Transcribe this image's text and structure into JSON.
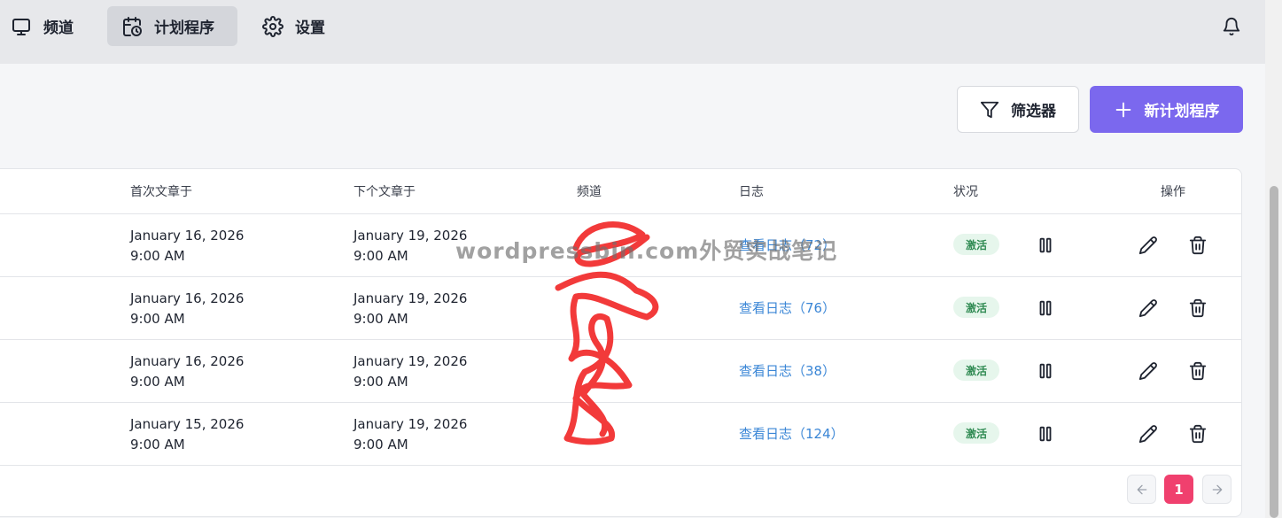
{
  "nav": {
    "channels": "频道",
    "schedules": "计划程序",
    "settings": "设置"
  },
  "actions": {
    "filter": "筛选器",
    "new_schedule": "新计划程序"
  },
  "table": {
    "headers": {
      "first_post": "首次文章于",
      "next_post": "下个文章于",
      "channel": "频道",
      "logs": "日志",
      "status": "状况",
      "actions": "操作"
    },
    "rows": [
      {
        "first_date": "January 16, 2026",
        "first_time": "9:00 AM",
        "next_date": "January 19, 2026",
        "next_time": "9:00 AM",
        "log": "查看日志（72）",
        "status": "激活"
      },
      {
        "first_date": "January 16, 2026",
        "first_time": "9:00 AM",
        "next_date": "January 19, 2026",
        "next_time": "9:00 AM",
        "log": "查看日志（76）",
        "status": "激活"
      },
      {
        "first_date": "January 16, 2026",
        "first_time": "9:00 AM",
        "next_date": "January 19, 2026",
        "next_time": "9:00 AM",
        "log": "查看日志（38）",
        "status": "激活"
      },
      {
        "first_date": "January 15, 2026",
        "first_time": "9:00 AM",
        "next_date": "January 19, 2026",
        "next_time": "9:00 AM",
        "log": "查看日志（124）",
        "status": "激活"
      }
    ]
  },
  "pagination": {
    "current": "1"
  },
  "watermark": "wordpressbin.com外贸实战笔记",
  "colors": {
    "accent": "#7b68ee",
    "page_active": "#f0406e",
    "link": "#3a86d6",
    "status_bg": "#e6f6ec",
    "status_text": "#2f8a52"
  },
  "icons": [
    "monitor-icon",
    "calendar-clock-icon",
    "gear-icon",
    "bell-icon",
    "filter-icon",
    "plus-icon",
    "pause-icon",
    "pencil-icon",
    "trash-icon",
    "arrow-left-icon",
    "arrow-right-icon"
  ]
}
